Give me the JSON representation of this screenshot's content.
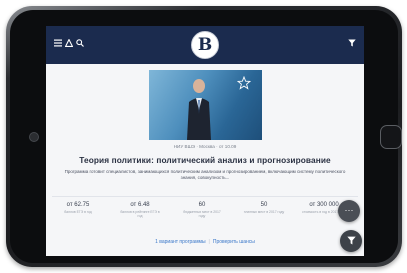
{
  "navbar": {
    "menu_icon": "menu-icon",
    "user_icon": "user-icon",
    "search_icon": "search-icon",
    "filter_icon": "filter-icon",
    "logo_text": "В",
    "background": "#1b2b4e"
  },
  "hero": {
    "badge_text": "",
    "colors": {
      "sky": "#4e8fbd",
      "suit": "#1e2430"
    }
  },
  "program": {
    "meta": "НИУ ВШЭ  ·  Москва  ·  от 10.09",
    "title": "Теория политики: политический анализ и прогнозирование",
    "description": "Программа готовит специалистов, занимающихся политическим анализом и прогнозированием, включающим систему политического знания, совокупность..."
  },
  "stats": [
    {
      "value": "от 62.75",
      "unit": "",
      "label": "баллов ЕГЭ в год"
    },
    {
      "value": "от 6.48",
      "unit": "",
      "label": "баллов в рейтинге ЕГЭ в год"
    },
    {
      "value": "60",
      "unit": "",
      "label": "бюджетных мест в 2017 году"
    },
    {
      "value": "50",
      "unit": "",
      "label": "платных мест в 2017 году"
    },
    {
      "value": "от 300 000",
      "unit": "",
      "label": "стоимость в год в 2017 году"
    }
  ],
  "links": {
    "primary": "1 вариант программы",
    "secondary": "Проверить шансы"
  },
  "fabs": {
    "more_label": "···",
    "filter_icon": "filter-icon"
  }
}
